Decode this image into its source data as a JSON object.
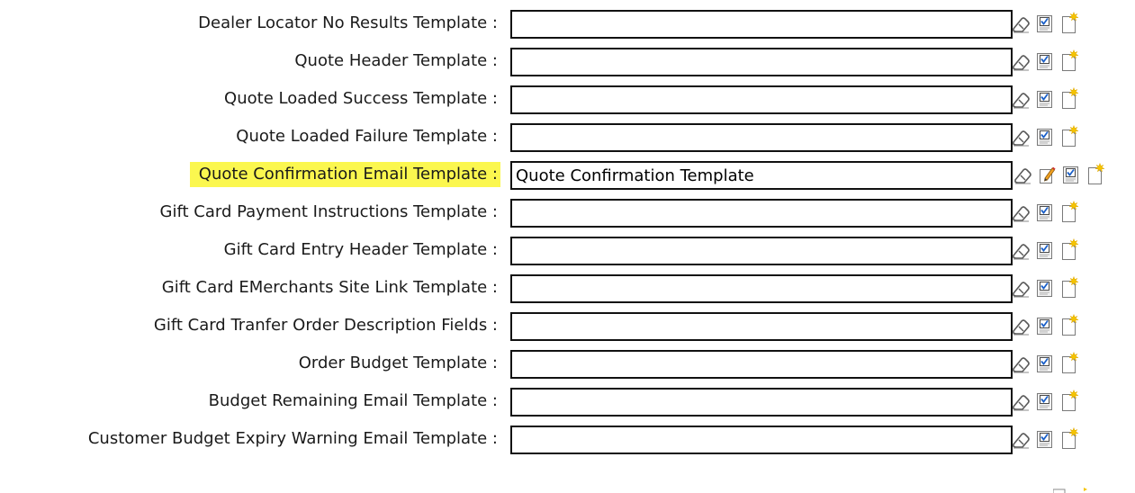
{
  "template_rows": [
    {
      "label": "Dealer Locator No Results Template :",
      "value": "",
      "highlighted": false,
      "icons": [
        "eraser-icon",
        "checkbox-edit-icon",
        "new-document-icon"
      ]
    },
    {
      "label": "Quote Header Template :",
      "value": "",
      "highlighted": false,
      "icons": [
        "eraser-icon",
        "checkbox-edit-icon",
        "new-document-icon"
      ]
    },
    {
      "label": "Quote Loaded Success Template :",
      "value": "",
      "highlighted": false,
      "icons": [
        "eraser-icon",
        "checkbox-edit-icon",
        "new-document-icon"
      ]
    },
    {
      "label": "Quote Loaded Failure Template :",
      "value": "",
      "highlighted": false,
      "icons": [
        "eraser-icon",
        "checkbox-edit-icon",
        "new-document-icon"
      ]
    },
    {
      "label": "Quote Confirmation Email Template :",
      "value": "Quote Confirmation Template",
      "highlighted": true,
      "icons": [
        "eraser-icon",
        "pencil-edit-icon",
        "checkbox-edit-icon",
        "new-document-icon"
      ]
    },
    {
      "label": "Gift Card Payment Instructions Template :",
      "value": "",
      "highlighted": false,
      "icons": [
        "eraser-icon",
        "checkbox-edit-icon",
        "new-document-icon"
      ]
    },
    {
      "label": "Gift Card Entry Header Template :",
      "value": "",
      "highlighted": false,
      "icons": [
        "eraser-icon",
        "checkbox-edit-icon",
        "new-document-icon"
      ]
    },
    {
      "label": "Gift Card EMerchants Site Link Template :",
      "value": "",
      "highlighted": false,
      "icons": [
        "eraser-icon",
        "checkbox-edit-icon",
        "new-document-icon"
      ]
    },
    {
      "label": "Gift Card Tranfer Order Description Fields :",
      "value": "",
      "highlighted": false,
      "icons": [
        "eraser-icon",
        "checkbox-edit-icon",
        "new-document-icon"
      ]
    },
    {
      "label": "Order Budget Template :",
      "value": "",
      "highlighted": false,
      "icons": [
        "eraser-icon",
        "checkbox-edit-icon",
        "new-document-icon"
      ]
    },
    {
      "label": "Budget Remaining Email Template :",
      "value": "",
      "highlighted": false,
      "icons": [
        "eraser-icon",
        "checkbox-edit-icon",
        "new-document-icon"
      ]
    },
    {
      "label": "Customer Budget Expiry Warning Email Template :",
      "value": "",
      "highlighted": false,
      "icons": [
        "eraser-icon",
        "checkbox-edit-icon",
        "new-document-icon"
      ]
    }
  ],
  "colors": {
    "highlight": "#fbf74f",
    "field_border": "#111111",
    "label_text": "#1a1a1a",
    "icon_star": "#f5c400"
  }
}
